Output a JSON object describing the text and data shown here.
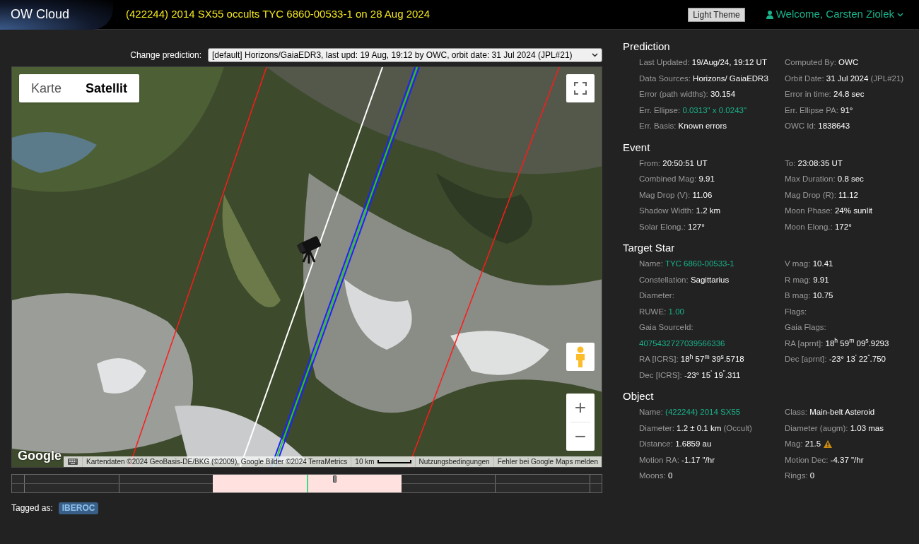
{
  "header": {
    "logo": "OW Cloud",
    "title": "(422244) 2014 SX55 occults TYC 6860-00533-1 on 28 Aug 2024",
    "theme_button": "Light Theme",
    "user": "Welcome, Carsten Ziolek"
  },
  "prediction_select": {
    "label": "Change prediction:",
    "value": "[default] Horizons/GaiaEDR3, last upd: 19 Aug, 19:12 by OWC, orbit date: 31 Jul 2024 (JPL#21)"
  },
  "map": {
    "map_types": [
      {
        "label": "Karte",
        "selected": false
      },
      {
        "label": "Satellit",
        "selected": true
      }
    ],
    "zoom_in": "+",
    "zoom_out": "−",
    "logo": "Google",
    "attribution": [
      "Kartendaten ©2024 GeoBasis-DE/BKG (©2009), Google Bilder ©2024 TerraMetrics",
      "10 km",
      "Nutzungsbedingungen",
      "Fehler bei Google Maps melden"
    ]
  },
  "tags": {
    "label": "Tagged as:",
    "items": [
      "IBEROC"
    ]
  },
  "sections": [
    {
      "title": "Prediction",
      "left": [
        {
          "label": "Last Updated:",
          "value": "19/Aug/24, 19:12 UT"
        },
        {
          "label": "Data Sources:",
          "value": "Horizons/ GaiaEDR3"
        },
        {
          "label": "Error (path widths):",
          "value": "30.154"
        },
        {
          "label": "Err. Ellipse:",
          "value": "0.0313\" x 0.0243\"",
          "kind": "link"
        },
        {
          "label": "Err. Basis:",
          "value": "Known errors"
        }
      ],
      "right": [
        {
          "label": "Computed By:",
          "value": "OWC"
        },
        {
          "label": "Orbit Date:",
          "value": "31 Jul 2024",
          "note": "(JPL#21)"
        },
        {
          "label": "Error in time:",
          "value": "24.8 sec"
        },
        {
          "label": "Err. Ellipse PA:",
          "value": "91°"
        },
        {
          "label": "OWC Id:",
          "value": "1838643"
        }
      ]
    },
    {
      "title": "Event",
      "left": [
        {
          "label": "From:",
          "value": "20:50:51 UT"
        },
        {
          "label": "Combined Mag:",
          "value": "9.91"
        },
        {
          "label": "Mag Drop (V):",
          "value": "11.06"
        },
        {
          "label": "Shadow Width:",
          "value": "1.2 km"
        },
        {
          "label": "Solar Elong.:",
          "value": "127°"
        }
      ],
      "right": [
        {
          "label": "To:",
          "value": "23:08:35 UT"
        },
        {
          "label": "Max Duration:",
          "value": "0.8 sec"
        },
        {
          "label": "Mag Drop (R):",
          "value": "11.12"
        },
        {
          "label": "Moon Phase:",
          "value": "24% sunlit"
        },
        {
          "label": "Moon Elong.:",
          "value": "172°"
        }
      ]
    },
    {
      "title": "Target Star",
      "left": [
        {
          "label": "Name:",
          "value": "TYC 6860-00533-1",
          "kind": "link"
        },
        {
          "label": "Constellation:",
          "value": "Sagittarius"
        },
        {
          "label": "Diameter:"
        },
        {
          "label": "RUWE:",
          "value": "1.00",
          "kind": "link"
        },
        {
          "label": "Gaia SourceId:",
          "value": "4075432727039566336",
          "kind": "link",
          "block": true
        },
        {
          "label": "RA [ICRS]:",
          "value": "18$^{h}$ 57$^{m}$ 39$^{s}$.5718"
        },
        {
          "label": "Dec [ICRS]:",
          "value": "-23° 15$^{'}$ 19$^{\"}$.311"
        }
      ],
      "right": [
        {
          "label": "V mag:",
          "value": "10.41"
        },
        {
          "label": "R mag:",
          "value": "9.91"
        },
        {
          "label": "B mag:",
          "value": "10.75"
        },
        {
          "label": "Flags:"
        },
        {
          "label": "Gaia Flags:"
        },
        {
          "label": "RA [aprnt]:",
          "value": "18$^{h}$ 59$^{m}$ 09$^{s}$.9293"
        },
        {
          "label": "Dec [aprnt]:",
          "value": "-23° 13$^{'}$ 22$^{\"}$.750"
        }
      ]
    },
    {
      "title": "Object",
      "left": [
        {
          "label": "Name:",
          "value": "(422244) 2014 SX55",
          "kind": "link"
        },
        {
          "label": "Diameter:",
          "value": "1.2 ± 0.1 km",
          "note": "(Occult)"
        },
        {
          "label": "Distance:",
          "value": "1.6859 au"
        },
        {
          "label": "Motion RA:",
          "value": "-1.17 \"/hr"
        },
        {
          "label": "Moons:",
          "value": "0"
        }
      ],
      "right": [
        {
          "label": "Class:",
          "value": "Main-belt Asteroid"
        },
        {
          "label": "Diameter (augm):",
          "value": "1.03 mas"
        },
        {
          "label": "Mag:",
          "value": "21.5",
          "warning": true
        },
        {
          "label": "Motion Dec:",
          "value": "-4.37 \"/hr"
        },
        {
          "label": "Rings:",
          "value": "0"
        }
      ]
    }
  ]
}
